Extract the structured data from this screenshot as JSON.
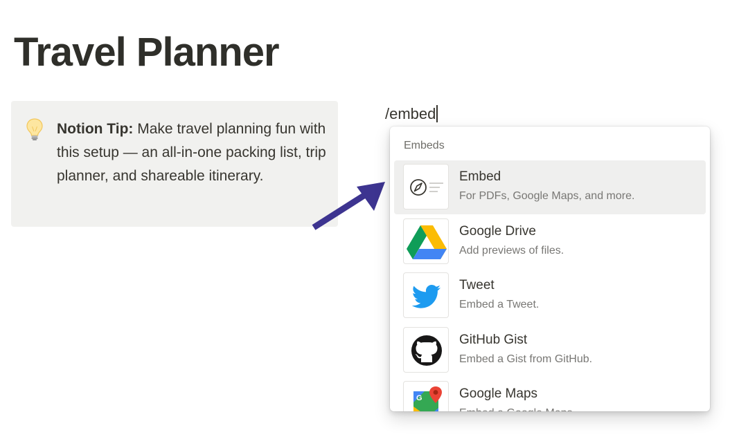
{
  "page": {
    "title": "Travel Planner"
  },
  "callout": {
    "icon": "lightbulb-icon",
    "bold_label": "Notion Tip:",
    "text": " Make travel planning fun with this setup — an all-in-one packing list, trip planner, and shareable itinerary."
  },
  "editor": {
    "slash_command": "/embed"
  },
  "menu": {
    "header": "Embeds",
    "items": [
      {
        "title": "Embed",
        "description": "For PDFs, Google Maps, and more.",
        "icon": "compass-embed-icon",
        "selected": true
      },
      {
        "title": "Google Drive",
        "description": "Add previews of files.",
        "icon": "google-drive-icon",
        "selected": false
      },
      {
        "title": "Tweet",
        "description": "Embed a Tweet.",
        "icon": "twitter-bird-icon",
        "selected": false
      },
      {
        "title": "GitHub Gist",
        "description": "Embed a Gist from GitHub.",
        "icon": "github-icon",
        "selected": false
      },
      {
        "title": "Google Maps",
        "description": "Embed a Google Maps",
        "icon": "google-maps-icon",
        "selected": false
      }
    ]
  },
  "colors": {
    "arrow": "#3d3490",
    "selected_row": "#efefee",
    "callout_bg": "#f1f1ef"
  }
}
